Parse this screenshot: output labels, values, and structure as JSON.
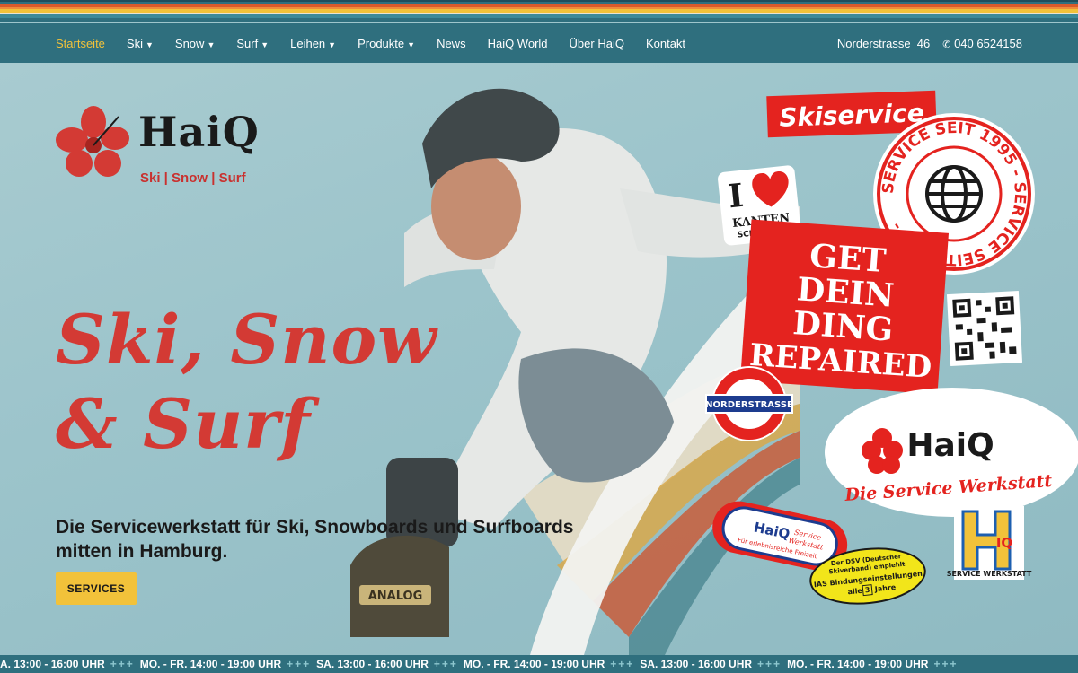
{
  "colors": {
    "nav_bg": "#2f6f7e",
    "accent_red": "#d33a34",
    "accent_yellow": "#f2c23a",
    "active_link": "#f2c23a"
  },
  "nav": {
    "items": [
      {
        "label": "Startseite",
        "active": true,
        "dropdown": false
      },
      {
        "label": "Ski",
        "dropdown": true
      },
      {
        "label": "Snow",
        "dropdown": true
      },
      {
        "label": "Surf",
        "dropdown": true
      },
      {
        "label": "Leihen",
        "dropdown": true
      },
      {
        "label": "Produkte",
        "dropdown": true
      },
      {
        "label": "News",
        "dropdown": false
      },
      {
        "label": "HaiQ World",
        "dropdown": false
      },
      {
        "label": "Über HaiQ",
        "dropdown": false
      },
      {
        "label": "Kontakt",
        "dropdown": false
      }
    ],
    "address": "Norderstrasse  46",
    "phone": "040 6524158",
    "phone_icon": "phone-icon"
  },
  "logo": {
    "name": "HaiQ",
    "tagline": "Ski | Snow | Surf",
    "icon": "hibiscus-flower-icon"
  },
  "hero": {
    "headline_line1": "Ski, Snow",
    "headline_line2": "& Surf",
    "subtitle_line1": "Die Servicewerkstatt für Ski, Snowboards und Surfboards",
    "subtitle_line2": "mitten in Hamburg.",
    "cta_label": "SERVICES",
    "photo_glove_text": "ANALOG"
  },
  "stickers": {
    "skiservice": "Skiservice",
    "circle_text": "SERVICE SEIT 1995 - SERVICE SEIT 1995 -",
    "globe_icon": "globe-icon",
    "i_love": "I",
    "heart_icon": "heart-icon",
    "kanten": "KANTEN",
    "schleifen": "SCHLEIFEN",
    "get_dein_lines": [
      "GET",
      "DEIN",
      "DING",
      "REPAIRED"
    ],
    "qr_icon": "qr-code-icon",
    "norderstrasse": "NORDERSTRASSE",
    "haiq_werkstatt_name": "HaiQ",
    "haiq_werkstatt_tagline": "Die Service Werkstatt",
    "oval_haiq": "HaiQ",
    "oval_service": "Service",
    "oval_werkstatt": "Werkstatt",
    "oval_slogan": "Für erlebnisreiche Freizeit",
    "dsv_line1": "Der DSV (Deutscher",
    "dsv_line2": "Skiverband) empiehlt",
    "dsv_line3": "IAS Bindungseinstellungen",
    "dsv_line4_pre": "alle",
    "dsv_line4_num": "3",
    "dsv_line4_post": "Jahre",
    "h_logo_text": "IQ",
    "h_logo_sub": "SERVICE WERKSTATT"
  },
  "ticker": {
    "segments": [
      "A. 13:00 - 16:00 UHR",
      "MO. - FR. 14:00 - 19:00 UHR",
      "SA. 13:00 - 16:00 UHR",
      "MO. - FR. 14:00 - 19:00 UHR",
      "SA. 13:00 - 16:00 UHR",
      "MO. - FR. 14:00 - 19:00 UHR"
    ],
    "separator": "+++"
  }
}
